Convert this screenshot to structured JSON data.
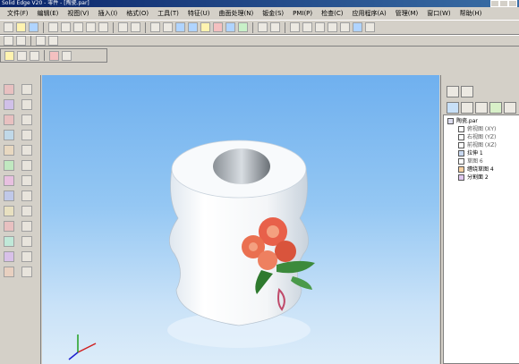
{
  "titlebar": {
    "title": "Solid Edge V20 - 零件 - [陶瓷.par]"
  },
  "menubar": {
    "items": [
      "文件(F)",
      "编辑(E)",
      "视图(V)",
      "插入(I)",
      "格式(O)",
      "工具(T)",
      "特征(U)",
      "曲面处理(N)",
      "钣金(S)",
      "PMI(P)",
      "检查(C)",
      "应用程序(A)",
      "管理(M)",
      "窗口(W)",
      "帮助(H)"
    ]
  },
  "tree": {
    "root": "陶瓷.par",
    "items": [
      {
        "label": "俯视图 (XY)",
        "icon": "plane-icon",
        "dim": true
      },
      {
        "label": "右视图 (YZ)",
        "icon": "plane-icon",
        "dim": true
      },
      {
        "label": "前视图 (XZ)",
        "icon": "plane-icon",
        "dim": true
      },
      {
        "label": "拉伸 1",
        "icon": "extrude-icon",
        "dim": false
      },
      {
        "label": "草图 6",
        "icon": "sketch-icon",
        "dim": true
      },
      {
        "label": "缠绕草图 4",
        "icon": "wrap-sketch-icon",
        "dim": false
      },
      {
        "label": "分割面 2",
        "icon": "split-face-icon",
        "dim": false
      }
    ]
  },
  "colors": {
    "viewport_top": "#6fb0ef",
    "viewport_bottom": "#dcecf9",
    "title_bar": "#0a246a",
    "model_body": "#ffffff",
    "rose": "#e8604a",
    "leaf": "#3c8a3c"
  }
}
